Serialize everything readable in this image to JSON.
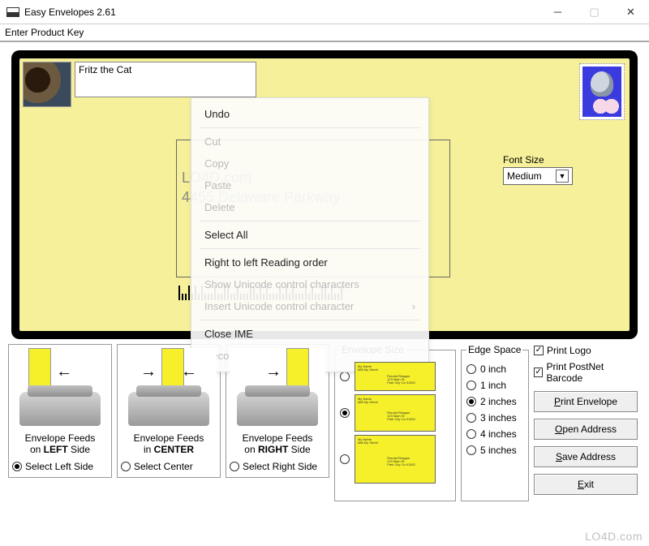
{
  "window": {
    "title": "Easy Envelopes 2.61"
  },
  "menubar": {
    "item": "Enter Product Key"
  },
  "envelope": {
    "return_name": "Fritz the Cat",
    "addr_line1": "LO4D.com",
    "addr_line2": "4455 Delaware Parkway",
    "font_label": "Font Size",
    "font_value": "Medium"
  },
  "context_menu": {
    "undo": "Undo",
    "cut": "Cut",
    "copy": "Copy",
    "paste": "Paste",
    "delete": "Delete",
    "select_all": "Select All",
    "rtl": "Right to left Reading order",
    "show_ucc": "Show Unicode control characters",
    "insert_ucc": "Insert Unicode control character",
    "close_ime": "Close IME",
    "reconversion": "Reconversion"
  },
  "feed": {
    "left_l1": "Envelope Feeds",
    "left_l2_a": "on ",
    "left_l2_b": "LEFT",
    "left_l2_c": " Side",
    "center_l1": "Envelope Feeds",
    "center_l2_a": "in ",
    "center_l2_b": "CENTER",
    "right_l1": "Envelope Feeds",
    "right_l2_a": "on ",
    "right_l2_b": "RIGHT",
    "right_l2_c": " Side",
    "radio_left": "Select Left Side",
    "radio_center": "Select Center",
    "radio_right": "Select Right Side",
    "selected": "left"
  },
  "env_size": {
    "legend": "Envelope Size",
    "selected": "medium"
  },
  "edge": {
    "legend": "Edge Space",
    "o0": "0 inch",
    "o1": "1 inch",
    "o2": "2 inches",
    "o3": "3 inches",
    "o4": "4 inches",
    "o5": "5 inches",
    "selected": "2"
  },
  "options": {
    "print_logo": "Print Logo",
    "print_barcode": "Print PostNet Barcode",
    "print_logo_checked": true,
    "print_barcode_checked": true
  },
  "buttons": {
    "print_a": "P",
    "print_b": "rint Envelope",
    "open_a": "O",
    "open_b": "pen Address",
    "save_a": "S",
    "save_b": "ave Address",
    "exit_a": "E",
    "exit_b": "xit"
  },
  "watermark": "LO4D.com"
}
